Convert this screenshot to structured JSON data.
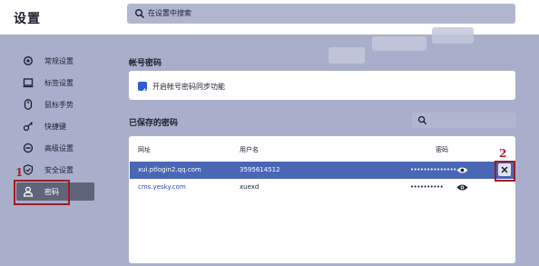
{
  "app": {
    "title": "设置"
  },
  "search": {
    "placeholder": "在设置中搜索"
  },
  "sidebar": {
    "items": [
      {
        "label": "常规设置",
        "icon": "gear-icon",
        "selected": false
      },
      {
        "label": "标签设置",
        "icon": "tab-icon",
        "selected": false
      },
      {
        "label": "鼠标手势",
        "icon": "mouse-icon",
        "selected": false
      },
      {
        "label": "快捷键",
        "icon": "key-icon",
        "selected": false
      },
      {
        "label": "高级设置",
        "icon": "minus-circle-icon",
        "selected": false
      },
      {
        "label": "安全设置",
        "icon": "shield-icon",
        "selected": false
      },
      {
        "label": "密码",
        "icon": "user-icon",
        "selected": true
      }
    ]
  },
  "account_section": {
    "title": "帐号密码",
    "sync_label": "开启帐号密码同步功能",
    "sync_checked": true
  },
  "saved_section": {
    "title": "已保存的密码",
    "columns": {
      "site": "网址",
      "username": "用户名",
      "password": "密码"
    },
    "rows": [
      {
        "site": "xui.ptlogin2.qq.com",
        "username": "3595614512",
        "password": "••••••••••••••",
        "selected": true
      },
      {
        "site": "cms.yesky.com",
        "username": "xuexd",
        "password": "••••••••••",
        "selected": false
      }
    ]
  },
  "annotations": {
    "one": "1",
    "two": "2"
  },
  "colors": {
    "accent": "#2f5bd5",
    "selected_row": "#4a67b5",
    "annotation": "#9e1c24",
    "background": "#a9afca"
  }
}
